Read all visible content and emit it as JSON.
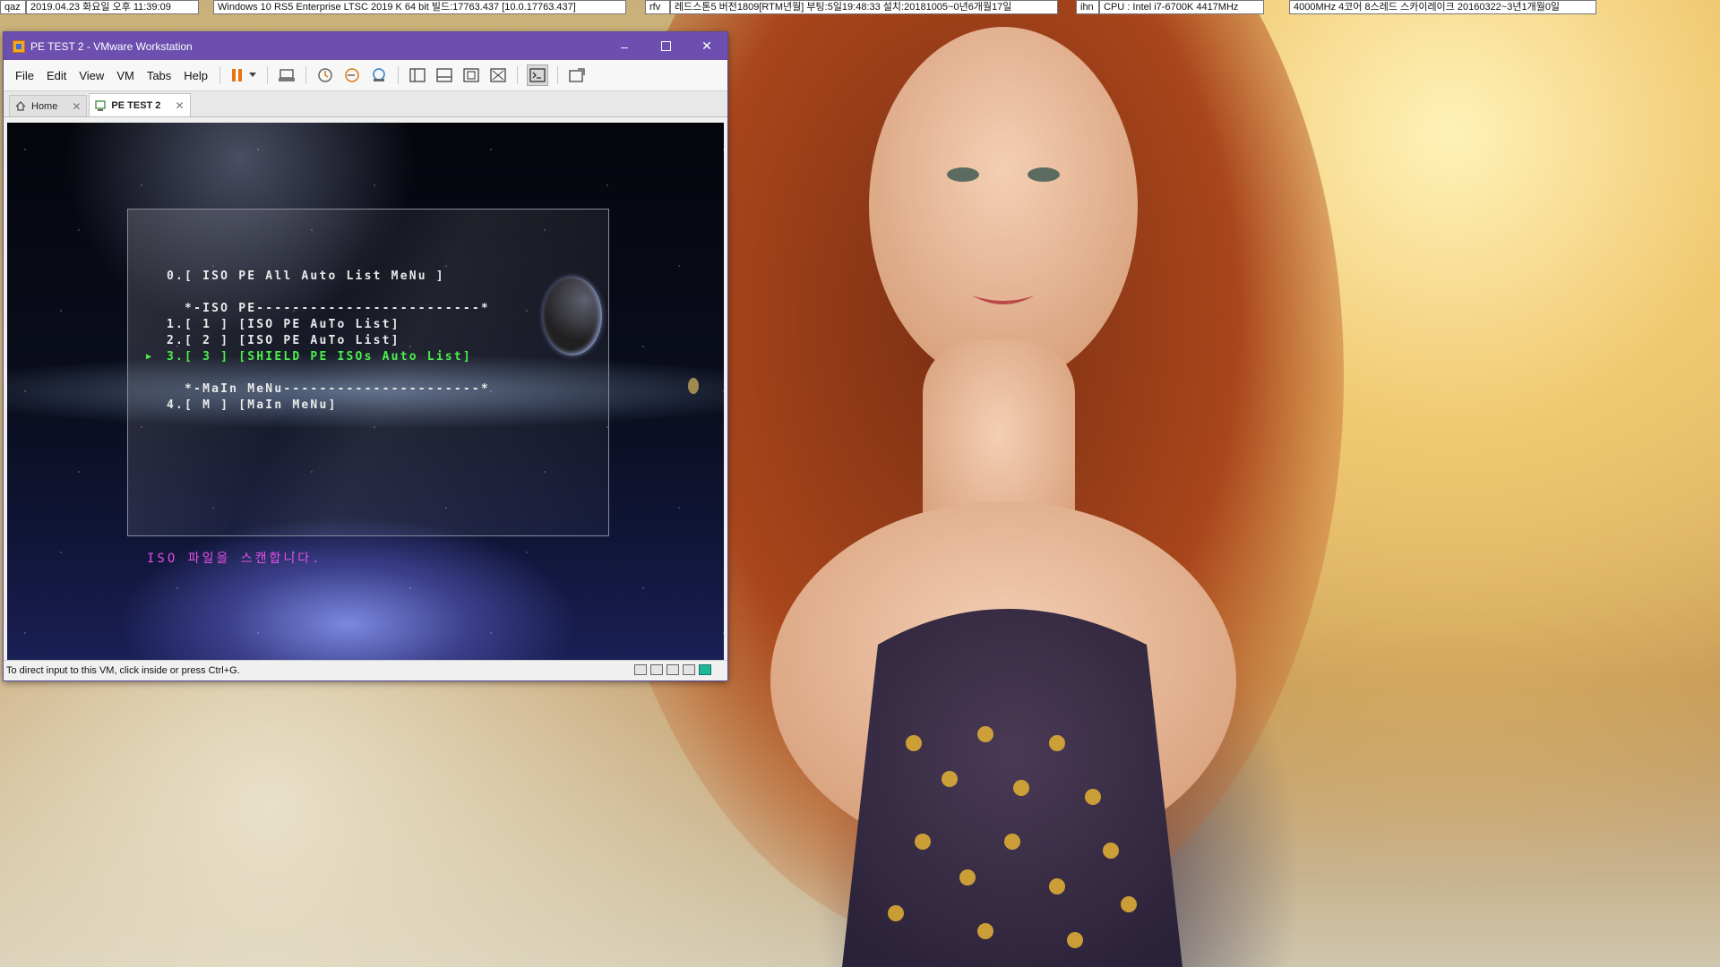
{
  "statusbar": {
    "segments": [
      "qaz",
      "2019.04.23 화요일 오후 11:39:09",
      "Windows 10 RS5 Enterprise LTSC 2019 K 64 bit 빌드:17763.437 [10.0.17763.437]",
      "rfv",
      "레드스톤5 버전1809[RTM년월] 부팅:5일19:48:33 설치:20181005~0년6개월17일",
      "ihn",
      "CPU : Intel i7-6700K 4417MHz",
      "4000MHz 4코어 8스레드 스카이레이크 20160322~3년1개월0일"
    ]
  },
  "window": {
    "title": "PE TEST 2 - VMware Workstation",
    "menu": [
      "File",
      "Edit",
      "View",
      "VM",
      "Tabs",
      "Help"
    ],
    "tabs": [
      {
        "label": "Home",
        "active": false
      },
      {
        "label": "PE TEST 2",
        "active": true
      }
    ],
    "status_text": "To direct input to this VM, click inside or press Ctrl+G."
  },
  "boot_menu": {
    "lines": [
      "0.[ ISO PE All Auto List MeNu ]",
      "  *-ISO PE-------------------------*",
      "1.[ 1 ] [ISO PE AuTo List]",
      "2.[ 2 ] [ISO PE AuTo List]",
      "3.[ 3 ] [SHIELD PE ISOs Auto List]",
      "  *-MaIn MeNu----------------------*",
      "4.[ M ] [MaIn MeNu]"
    ],
    "selected_index": 4,
    "selected_marker": "▶",
    "scan_message": "ISO 파일을 스캔합니다.",
    "colors": {
      "normal": "#eaeaea",
      "selected": "#4cf04c",
      "scan": "#e64fe6"
    }
  },
  "icons": {
    "titlebar": "vmware-app-icon",
    "window_controls": [
      "minimize-icon",
      "maximize-icon",
      "close-icon"
    ],
    "toolbar": [
      "pause-icon",
      "dropdown-arrow-icon",
      "send-ctrl-alt-del-icon",
      "snapshot-icon",
      "revert-snapshot-icon",
      "snapshot-manager-icon",
      "library-icon",
      "thumbnail-bar-icon",
      "fullscreen-icon",
      "unity-icon",
      "console-icon",
      "autofit-icon"
    ],
    "status_devices": [
      "hard-disk-icon",
      "network-icon",
      "printer-icon",
      "sound-icon",
      "display-icon"
    ]
  }
}
